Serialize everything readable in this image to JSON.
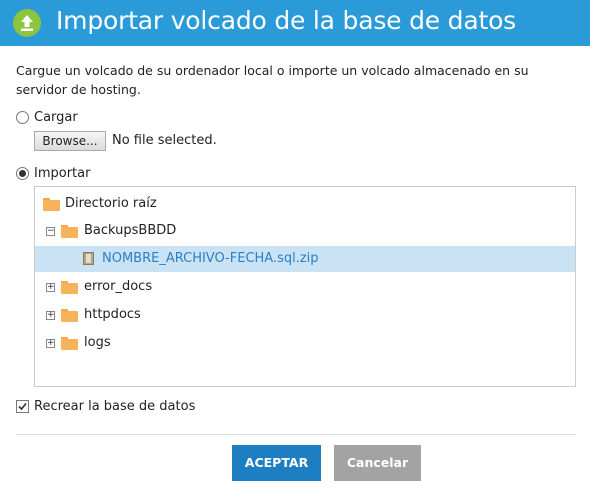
{
  "dialog": {
    "title": "Importar volcado de la base de datos",
    "description": "Cargue un volcado de su ordenador local o importe un volcado almacenado en su servidor de hosting."
  },
  "options": {
    "upload": {
      "label": "Cargar",
      "checked": false
    },
    "import": {
      "label": "Importar",
      "checked": true
    }
  },
  "file_input": {
    "button_label": "Browse...",
    "status": "No file selected."
  },
  "tree": {
    "root": {
      "label": "Directorio raíz",
      "icon": "folder-icon"
    },
    "items": [
      {
        "label": "BackupsBBDD",
        "icon": "folder-icon",
        "expander": "⊟",
        "expanded": true
      },
      {
        "label": "NOMBRE_ARCHIVO-FECHA.sql.zip",
        "icon": "zip-file-icon",
        "selected": true
      },
      {
        "label": "error_docs",
        "icon": "folder-icon",
        "expander": "⊞",
        "expanded": false
      },
      {
        "label": "httpdocs",
        "icon": "folder-icon",
        "expander": "⊞",
        "expanded": false
      },
      {
        "label": "logs",
        "icon": "folder-icon",
        "expander": "⊞",
        "expanded": false
      }
    ]
  },
  "recreate": {
    "label": "Recrear la base de datos",
    "checked": true
  },
  "buttons": {
    "accept": "ACEPTAR",
    "cancel": "Cancelar"
  },
  "colors": {
    "titlebar": "#2b9ad9",
    "icon_green": "#8cc63f",
    "primary": "#1d7fc1",
    "secondary": "#a3a3a3",
    "selection": "#c9e3f5",
    "folder": "#f7b35c"
  }
}
